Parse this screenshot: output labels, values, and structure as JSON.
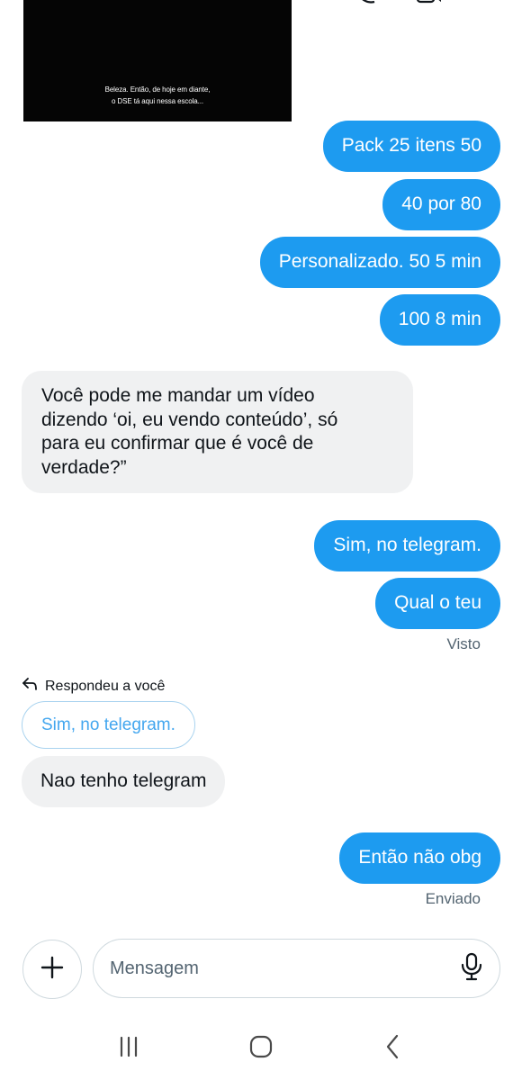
{
  "colors": {
    "sent_bubble": "#1d9bf0",
    "received_bubble": "#f0f1f2",
    "status_text": "#536471",
    "reply_quote_text": "#44a7ef"
  },
  "video_message": {
    "caption_line1": "Beleza. Então, de hoje em diante,",
    "caption_line2": "o DSE tá aqui nessa escola..."
  },
  "messages": [
    {
      "direction": "sent",
      "text": "Pack 25 itens 50"
    },
    {
      "direction": "sent",
      "text": "40 por 80"
    },
    {
      "direction": "sent",
      "text": "Personalizado. 50 5 min"
    },
    {
      "direction": "sent",
      "text": "100 8 min"
    },
    {
      "direction": "received",
      "lines": [
        "Você pode me mandar um vídeo",
        "dizendo ‘oi, eu vendo conteúdo’, só",
        "para eu confirmar que é você de",
        "verdade?”"
      ]
    },
    {
      "direction": "sent",
      "text": "Sim, no telegram."
    },
    {
      "direction": "sent",
      "text": "Qual o teu",
      "status": "Visto"
    },
    {
      "direction": "received",
      "text": "Nao tenho telegram",
      "reply_label": "Respondeu a você",
      "reply_quote": "Sim, no telegram."
    },
    {
      "direction": "sent",
      "text": "Então não obg",
      "status": "Enviado"
    }
  ],
  "composer": {
    "placeholder": "Mensagem",
    "add_icon": "plus-icon",
    "mic_icon": "microphone-icon"
  },
  "nav_bar": {
    "icons": [
      "recent-apps-icon",
      "home-icon",
      "back-icon"
    ]
  }
}
